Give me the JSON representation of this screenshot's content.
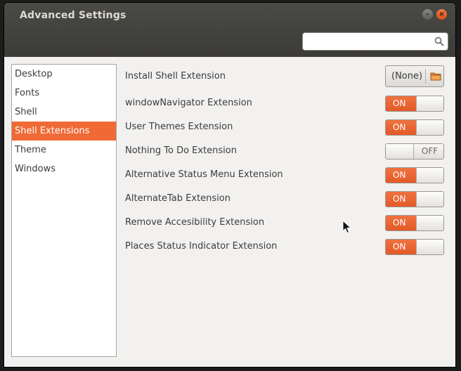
{
  "window": {
    "title": "Advanced Settings"
  },
  "search": {
    "value": "",
    "placeholder": ""
  },
  "sidebar": {
    "items": [
      {
        "label": "Desktop"
      },
      {
        "label": "Fonts"
      },
      {
        "label": "Shell"
      },
      {
        "label": "Shell Extensions",
        "selected": true
      },
      {
        "label": "Theme"
      },
      {
        "label": "Windows"
      }
    ]
  },
  "content": {
    "install": {
      "label": "Install Shell Extension",
      "button_value": "(None)"
    },
    "extensions": [
      {
        "label": "windowNavigator Extension",
        "state": "ON"
      },
      {
        "label": "User Themes Extension",
        "state": "ON"
      },
      {
        "label": "Nothing To Do Extension",
        "state": "OFF"
      },
      {
        "label": "Alternative Status Menu Extension",
        "state": "ON"
      },
      {
        "label": "AlternateTab Extension",
        "state": "ON"
      },
      {
        "label": "Remove Accesibility Extension",
        "state": "ON"
      },
      {
        "label": "Places Status Indicator Extension",
        "state": "ON"
      }
    ]
  },
  "colors": {
    "accent": "#ef6a35",
    "titlebar": "#3c3b37",
    "background": "#f2f1f0"
  },
  "icons": [
    "minimize-icon",
    "close-icon",
    "search-icon",
    "folder-icon",
    "mouse-cursor-icon"
  ]
}
